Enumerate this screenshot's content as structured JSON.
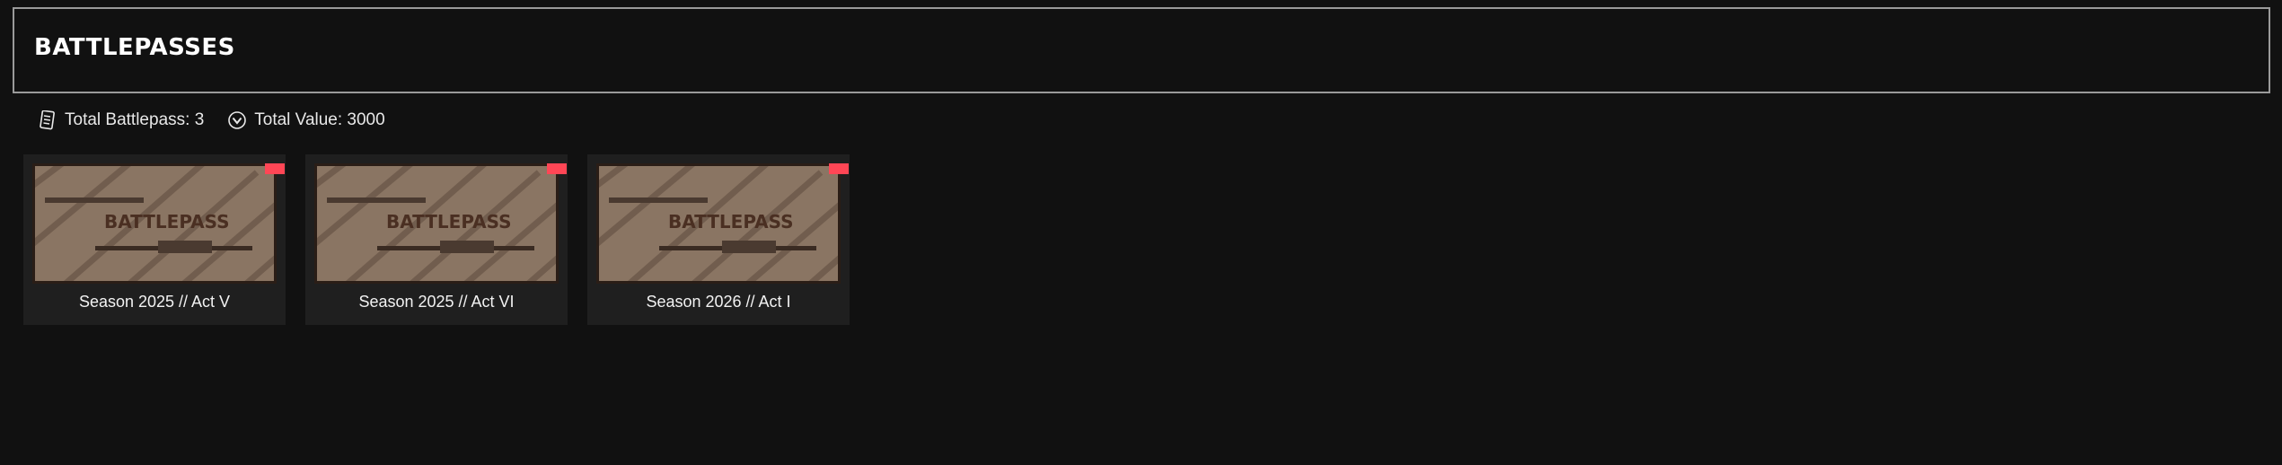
{
  "header": {
    "title": "BATTLEPASSES"
  },
  "stats": {
    "total_battlepass": "Total Battlepass: 3",
    "total_value": "Total Value: 3000"
  },
  "cards": [
    {
      "name": "Season 2025 // Act V",
      "image_text": "BATTLEPASS"
    },
    {
      "name": "Season 2025 // Act VI",
      "image_text": "BATTLEPASS"
    },
    {
      "name": "Season 2026 // Act I",
      "image_text": "BATTLEPASS"
    }
  ],
  "icons": {
    "battlepass": "battlepass-card-icon",
    "value": "radianite-coin-icon"
  },
  "colors": {
    "background": "#111111",
    "card": "#1f1f1f",
    "accent": "#ff4655",
    "thumb_tone": "#8a7563"
  }
}
